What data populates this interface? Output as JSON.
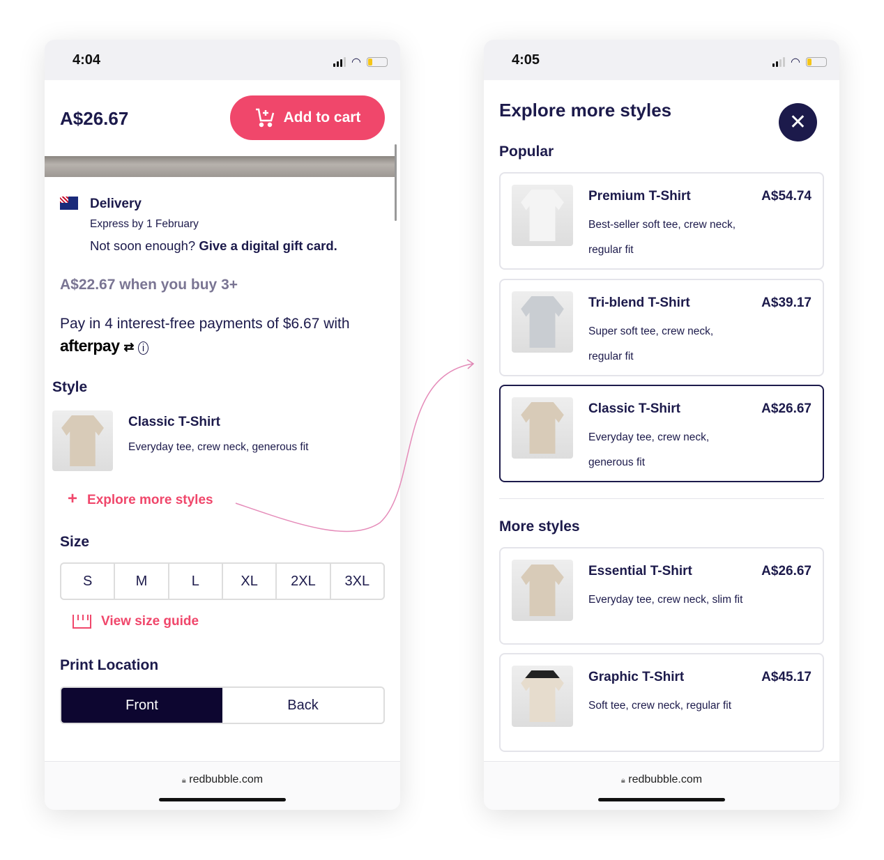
{
  "left": {
    "status": {
      "time": "4:04"
    },
    "price": "A$26.67",
    "add_to_cart": "Add to cart",
    "delivery": {
      "title": "Delivery",
      "express": "Express by 1 February",
      "prompt": "Not soon enough?",
      "gift_link": "Give a digital gift card."
    },
    "bulk_price": "A$22.67 when you buy 3+",
    "afterpay": {
      "text": "Pay in 4 interest-free payments of $6.67 with",
      "brand": "afterpay"
    },
    "style": {
      "heading": "Style",
      "name": "Classic T-Shirt",
      "desc": "Everyday tee, crew neck, generous fit",
      "explore": "Explore more styles"
    },
    "size": {
      "heading": "Size",
      "options": [
        "S",
        "M",
        "L",
        "XL",
        "2XL",
        "3XL"
      ],
      "guide": "View size guide"
    },
    "print_location": {
      "heading": "Print Location",
      "options": [
        "Front",
        "Back"
      ],
      "selected": "Front"
    },
    "url": "redbubble.com"
  },
  "right": {
    "status": {
      "time": "4:05"
    },
    "title": "Explore more styles",
    "popular_heading": "Popular",
    "popular": [
      {
        "name": "Premium T-Shirt",
        "price": "A$54.74",
        "desc": "Best-seller soft tee, crew neck, regular fit"
      },
      {
        "name": "Tri-blend T-Shirt",
        "price": "A$39.17",
        "desc": "Super soft tee, crew neck, regular fit"
      },
      {
        "name": "Classic T-Shirt",
        "price": "A$26.67",
        "desc": "Everyday tee, crew neck, generous fit"
      }
    ],
    "more_heading": "More styles",
    "more": [
      {
        "name": "Essential T-Shirt",
        "price": "A$26.67",
        "desc": "Everyday tee, crew neck, slim fit"
      },
      {
        "name": "Graphic T-Shirt",
        "price": "A$45.17",
        "desc": "Soft tee, crew neck, regular fit"
      }
    ],
    "url": "redbubble.com"
  },
  "colors": {
    "accent": "#f0476b",
    "navy": "#1c1a4b",
    "selected": "#0d0630",
    "muted": "#7a7593"
  }
}
